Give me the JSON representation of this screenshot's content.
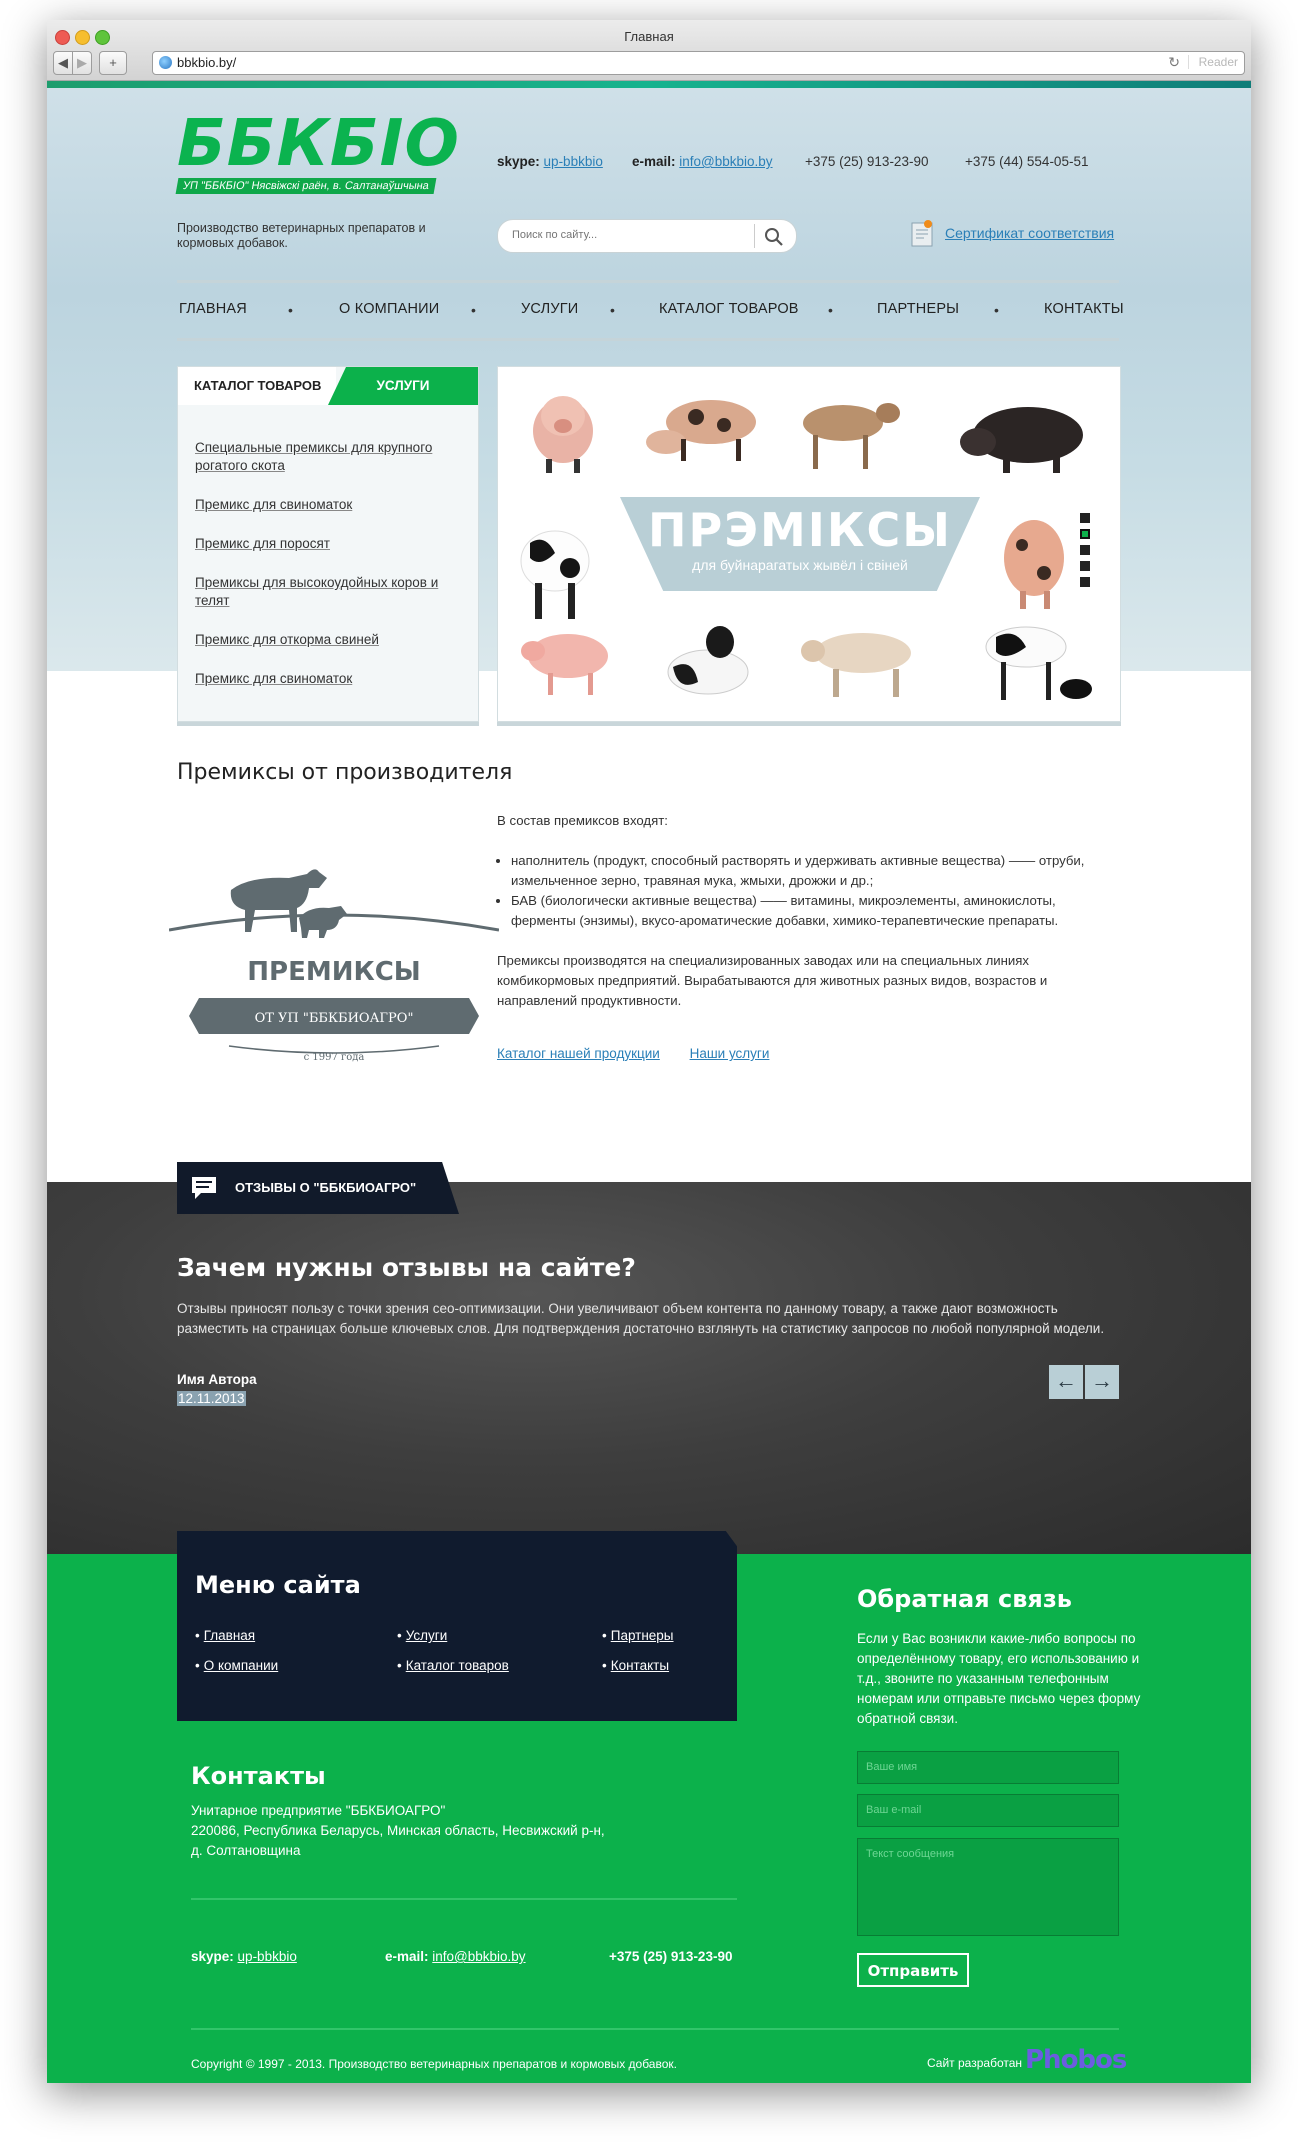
{
  "browser": {
    "title": "Главная",
    "url": "bbkbio.by/",
    "reader_label": "Reader",
    "back_icon": "chevron-left-icon",
    "forward_icon": "chevron-right-icon",
    "add_tab_icon": "plus-icon"
  },
  "header": {
    "logo_text": "ББКБІО",
    "logo_sub": "УП \"ББКБІО\" Нясвіжскі раён, в. Салтанаўшчына",
    "tagline": "Производство ветеринарных препаратов и кормовых добавок.",
    "skype_label": "skype:",
    "skype_value": "up-bbkbio",
    "email_label": "e-mail:",
    "email_value": "info@bbkbio.by",
    "phone1": "+375 (25) 913-23-90",
    "phone2": "+375 (44) 554-05-51",
    "search_placeholder": "Поиск по сайту...",
    "certificate": "Сертификат соответствия"
  },
  "nav": {
    "items": [
      "Главная",
      "О компании",
      "Услуги",
      "Каталог товаров",
      "Партнеры",
      "Контакты"
    ]
  },
  "sidebar": {
    "tab_catalog": "КАТАЛОГ ТОВАРОВ",
    "tab_services": "УСЛУГИ",
    "items": [
      "Специальные премиксы для крупного рогатого скота",
      "Премикс для свиноматок",
      "Премикс для поросят",
      "Премиксы для высокоудойных коров и телят",
      "Премикс для откорма свиней",
      "Премикс для свиноматок"
    ]
  },
  "banner": {
    "title": "ПРЭМІКСЫ",
    "subtitle": "для буйнарагатых жывёл і свіней",
    "slides_total": 5,
    "slide_active": 2
  },
  "intro": {
    "title": "Премиксы от производителя",
    "logo_title": "ПРЕМИКСЫ",
    "logo_ribbon": "ОТ УП \"ББКБИОАГРО\"",
    "logo_since": "с 1997 года",
    "p1": "В состав премиксов входят:",
    "bullets": [
      "наполнитель (продукт, способный растворять и удерживать активные вещества) —— отруби, измельченное зерно, травяная мука, жмыхи, дрожжи и др.;",
      "БАВ (биологически активные вещества) —— витамины, микроэлементы, аминокислоты, ферменты (энзимы), вкусо-ароматические добавки, химико-терапевтические препараты."
    ],
    "p2": "Премиксы производятся на специализированных заводах или на специальных линиях комбикормовых предприятий. Вырабатываются для животных разных видов, возрастов и направлений продуктивности.",
    "link_catalog": "Каталог нашей продукции",
    "link_services": "Наши услуги"
  },
  "reviews": {
    "tab_label": "ОТЗЫВЫ О \"ББКБИОАГРО\"",
    "title": "Зачем нужны отзывы на сайте?",
    "text": "Отзывы приносят пользу с точки зрения сео-оптимизации. Они увеличивают объем контента по данному товару, а также дают возможность разместить на страницах больше ключевых слов. Для подтверждения достаточно взглянуть на статистику запросов по любой популярной модели.",
    "author": "Имя Автора",
    "date": "12.11.2013",
    "prev": "←",
    "next": "→"
  },
  "footer": {
    "menu_title": "Меню сайта",
    "menu": [
      "Главная",
      "О компании",
      "Услуги",
      "Каталог товаров",
      "Партнеры",
      "Контакты"
    ],
    "contacts_title": "Контакты",
    "contacts_lines": [
      "Унитарное предприятие \"ББКБИОАГРО\"",
      "220086, Республика Беларусь, Минская область, Несвижский р-н,",
      "д. Солтановщина"
    ],
    "skype_label": "skype:",
    "skype_value": "up-bbkbio",
    "email_label": "e-mail:",
    "email_value": "info@bbkbio.by",
    "phone": "+375 (25) 913-23-90",
    "feedback_title": "Обратная связь",
    "feedback_text": "Если у Вас возникли какие-либо вопросы по определённому товару, его использованию и т.д., звоните по указанным телефонным номерам или отправьте письмо через форму обратной связи.",
    "field_name": "Ваше имя",
    "field_email": "Ваш e-mail",
    "field_message": "Текст сообщения",
    "submit": "Отправить",
    "copyright": "Copyright © 1997 - 2013. Производство ветеринарных препаратов и кормовых добавок.",
    "developer_label": "Сайт разработан",
    "developer_logo": "Phobos"
  },
  "colors": {
    "brand_green": "#0cb14b",
    "link_blue": "#2a7fb7",
    "dark_navy": "#101b2e"
  }
}
